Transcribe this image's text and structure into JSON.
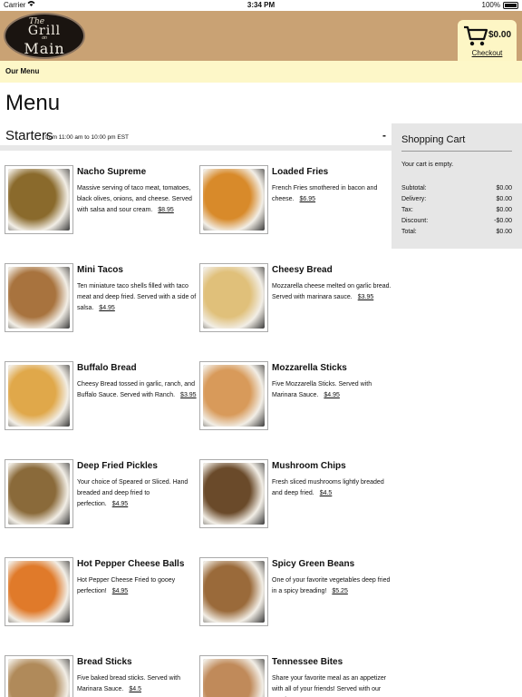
{
  "status": {
    "carrier": "Carrier",
    "time": "3:34 PM",
    "battery": "100%"
  },
  "logo": {
    "the": "The",
    "line1": "Grill",
    "on": "on",
    "line2": "Main"
  },
  "header": {
    "cart_total": "$0.00",
    "checkout": "Checkout"
  },
  "subnav": {
    "item": "Our Menu"
  },
  "page": {
    "title": "Menu"
  },
  "section": {
    "title": "Starters",
    "hours": "from 11:00 am to 10:00 pm EST",
    "toggle": "-"
  },
  "cart": {
    "title": "Shopping Cart",
    "empty": "Your cart is empty.",
    "rows": [
      {
        "label": "Subtotal:",
        "value": "$0.00"
      },
      {
        "label": "Delivery:",
        "value": "$0.00"
      },
      {
        "label": "Tax:",
        "value": "$0.00"
      },
      {
        "label": "Discount:",
        "value": "-$0.00"
      },
      {
        "label": "Total:",
        "value": "$0.00"
      }
    ]
  },
  "items": [
    {
      "name": "Nacho Supreme",
      "desc": "Massive serving of taco meat, tomatoes, black olives, onions, and cheese. Served with salsa and sour cream.",
      "price": "$8.95",
      "color": "#8a6a2c"
    },
    {
      "name": "Loaded Fries",
      "desc": "French Fries smothered in bacon and cheese.",
      "price": "$6.95",
      "color": "#d88a2a"
    },
    {
      "name": "Mini Tacos",
      "desc": "Ten miniature taco shells filled with taco meat and deep fried. Served with a side of salsa.",
      "price": "$4.95",
      "color": "#a8733e"
    },
    {
      "name": "Cheesy Bread",
      "desc": "Mozzarella cheese melted on garlic bread. Served with marinara sauce.",
      "price": "$3.95",
      "color": "#e0c07a"
    },
    {
      "name": "Buffalo Bread",
      "desc": "Cheesy Bread tossed in garlic, ranch, and Buffalo Sauce. Served with Ranch.",
      "price": "$3.95",
      "color": "#e0a84a"
    },
    {
      "name": "Mozzarella Sticks",
      "desc": "Five Mozzarella Sticks. Served with Marinara Sauce.",
      "price": "$4.95",
      "color": "#d89a5a"
    },
    {
      "name": "Deep Fried Pickles",
      "desc": "Your choice of Speared or Sliced. Hand breaded and deep fried to perfection.",
      "price": "$4.95",
      "color": "#8a6a3a"
    },
    {
      "name": "Mushroom Chips",
      "desc": "Fresh sliced mushrooms lightly breaded and deep fried.",
      "price": "$4.5",
      "color": "#6a4a2a"
    },
    {
      "name": "Hot Pepper Cheese Balls",
      "desc": "Hot Pepper Cheese Fried to gooey perfection!",
      "price": "$4.95",
      "color": "#e07a2a"
    },
    {
      "name": "Spicy Green Beans",
      "desc": "One of your favorite vegetables deep fried in a spicy breading!",
      "price": "$5.25",
      "color": "#9a6a3a"
    },
    {
      "name": "Bread Sticks",
      "desc": "Five baked bread sticks. Served with Marinara Sauce.",
      "price": "$4.5",
      "color": "#b08a5a"
    },
    {
      "name": "Tennessee Bites",
      "desc": "Share your favorite meal as an appetizer with all of your friends! Served with our Southern",
      "price": "",
      "color": "#c08a5a"
    }
  ]
}
